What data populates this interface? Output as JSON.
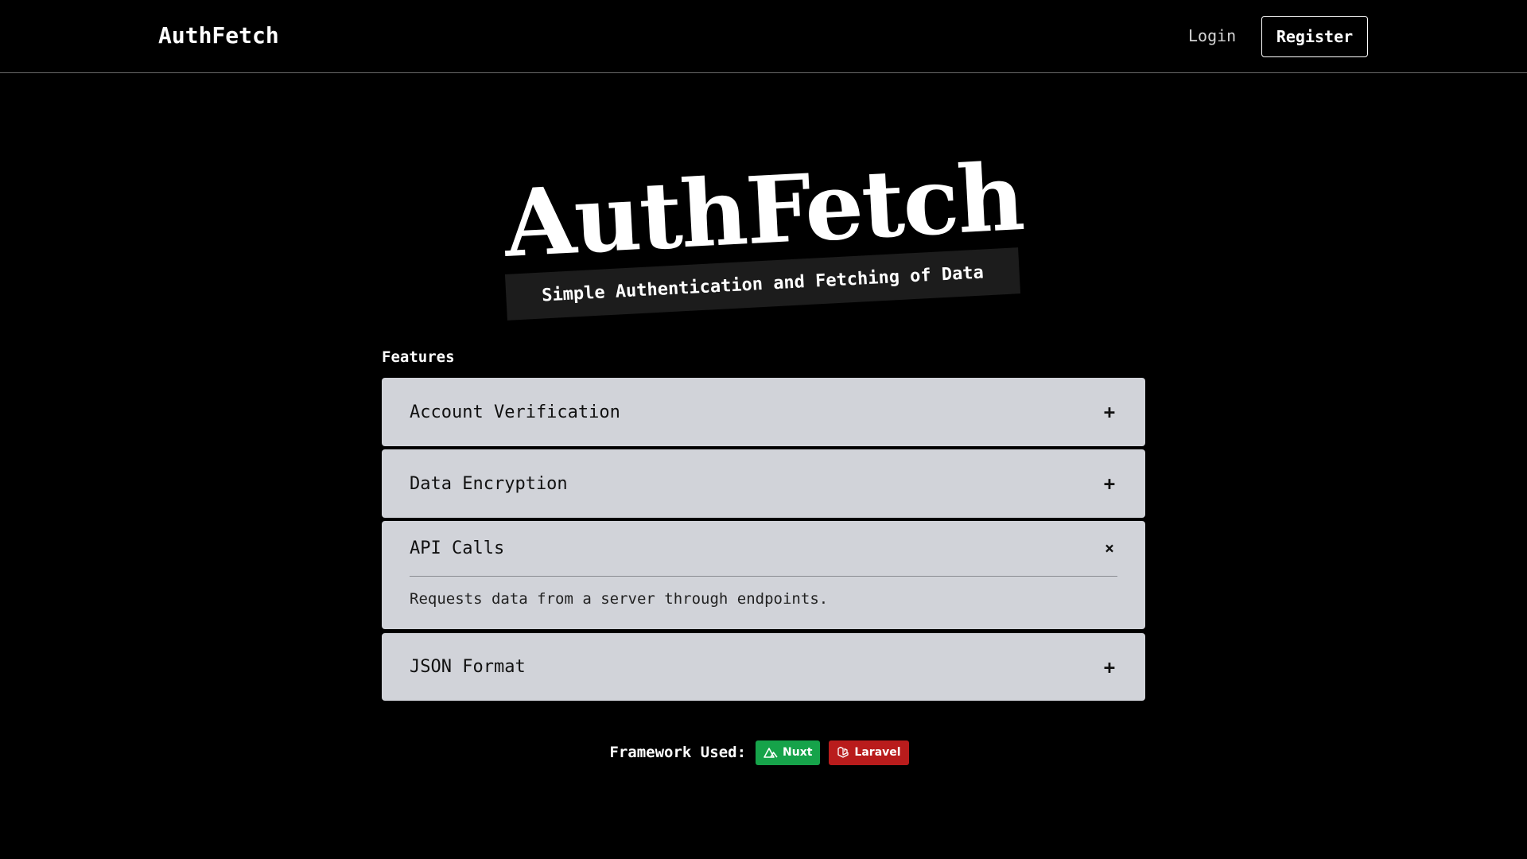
{
  "navbar": {
    "brand": "AuthFetch",
    "login_label": "Login",
    "register_label": "Register"
  },
  "hero": {
    "title": "AuthFetch",
    "subtitle": "Simple Authentication and Fetching of Data"
  },
  "features": {
    "label": "Features",
    "items": [
      {
        "title": "Account Verification",
        "toggle": "+",
        "expanded": false
      },
      {
        "title": "Data Encryption",
        "toggle": "+",
        "expanded": false
      },
      {
        "title": "API Calls",
        "toggle": "×",
        "expanded": true,
        "body": "Requests data from a server through endpoints."
      },
      {
        "title": "JSON Format",
        "toggle": "+",
        "expanded": false
      }
    ]
  },
  "framework": {
    "label": "Framework Used:",
    "badges": [
      {
        "label": "Nuxt",
        "icon": "nuxt-icon",
        "color": "#16a34a"
      },
      {
        "label": "Laravel",
        "icon": "laravel-icon",
        "color": "#b91c1c"
      }
    ]
  },
  "colors": {
    "background": "#000000",
    "accordion_bg": "#d1d3d9",
    "subtitle_bg": "#1c1c1c"
  }
}
